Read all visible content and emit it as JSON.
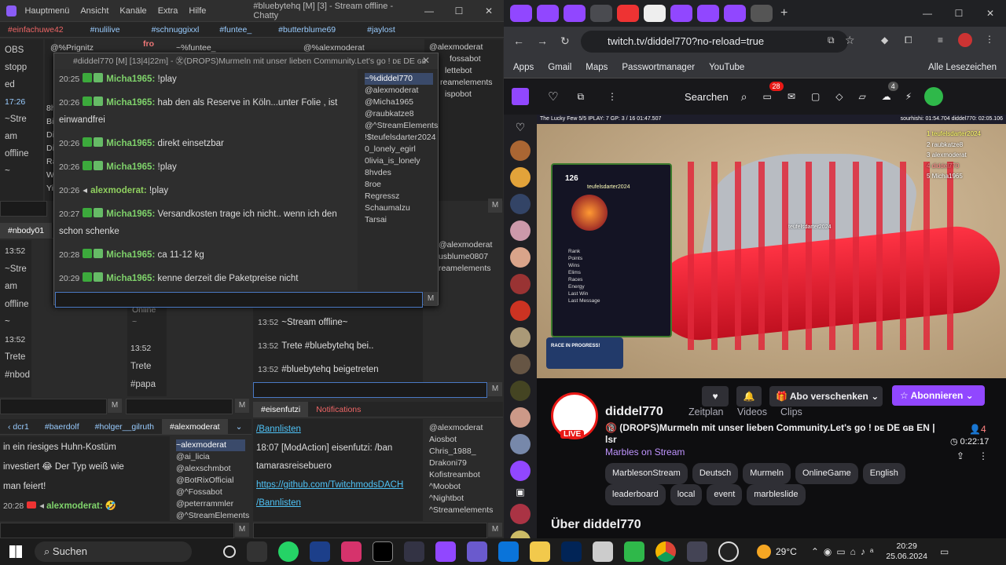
{
  "chatty": {
    "menu": [
      "Hauptmenü",
      "Ansicht",
      "Kanäle",
      "Extra",
      "Hilfe"
    ],
    "title": "#bluebytehq [M] [3] - Stream offline - Chatty",
    "win_controls": [
      "—",
      "☐",
      "✕"
    ],
    "tabs_top": [
      "#einfachuwe42",
      "#nulilive",
      "#schnuggixxl",
      "#funtee_",
      "#butterblume69",
      "#jaylost"
    ],
    "col1_lines": [
      "OBS",
      "stopp",
      "ed",
      "17:26",
      "~Stre",
      "am",
      "offline",
      "~"
    ],
    "col1_pre": "@%Prignitz",
    "col2_pre": "fro",
    "col3_pre": "~%funtee_",
    "col4_pre": "@%alexmoderat",
    "col5_list": [
      "@alexmoderat",
      "fossabot",
      "lettebot",
      "reamelements",
      "ispobot"
    ],
    "col1_side": [
      "8h",
      "Bi",
      "Di",
      "Di",
      "Ra",
      "W",
      "Yi"
    ],
    "mid_tabs": [
      "#nbody01"
    ],
    "mid_col1": [
      "13:52",
      "~Stre",
      "am",
      "offline",
      "~",
      "13:52",
      "Trete",
      "#nbod"
    ],
    "mid_col2": [
      "Online",
      "~"
    ],
    "mid_col3": [
      "13:52",
      "Trete",
      "#papa"
    ],
    "mid_main": [
      {
        "ts": "13:52",
        "text": "~Stream offline~"
      },
      {
        "ts": "13:52",
        "text": "Trete #bluebytehq bei.."
      },
      {
        "ts": "13:52",
        "text": "#bluebytehq beigetreten"
      }
    ],
    "mid_users": [
      "@alexmoderat",
      "usblume0807",
      "reamelements"
    ],
    "popup": {
      "header": "#diddel770 [M] [13|4|22m] - ㉆(DROPS)Murmeln mit unser lieben Community.Let's go ! ᴅᴇ DE ɢʙ",
      "close": "✕",
      "messages": [
        {
          "ts": "20:25",
          "nick": "Micha1965:",
          "text": "!play"
        },
        {
          "ts": "20:26",
          "nick": "Micha1965:",
          "text": "hab den als Reserve in Köln...unter Folie , ist einwandfrei"
        },
        {
          "ts": "20:26",
          "nick": "Micha1965:",
          "text": "direkt einsetzbar"
        },
        {
          "ts": "20:26",
          "nick": "Micha1965:",
          "text": "!play"
        },
        {
          "ts": "20:26",
          "nick": "alexmoderat:",
          "text": "!play"
        },
        {
          "ts": "20:27",
          "nick": "Micha1965:",
          "text": "Versandkosten trage ich nicht.. wenn ich den schon schenke"
        },
        {
          "ts": "20:28",
          "nick": "Micha1965:",
          "text": "ca 11-12 kg"
        },
        {
          "ts": "20:29",
          "nick": "Micha1965:",
          "text": "kenne derzeit die Paketpreise nicht"
        }
      ],
      "users": [
        "~%diddel770",
        "@alexmoderat",
        "@Micha1965",
        "@raubkatze8",
        "@^StreamElements",
        "!$teufelsdarter2024",
        "0_lonely_egirl",
        "0livia_is_lonely",
        "8hvdes",
        "8roe",
        "Regressz",
        "Schaumalzu",
        "Tarsai"
      ],
      "m": "M"
    },
    "bottom_tabs": [
      "dcr1",
      "#baerdolf",
      "#holger__gilruth",
      "#alexmoderat"
    ],
    "bottom_chat": [
      "in ein riesiges Huhn-Kostüm",
      "investiert 😂 Der Typ weiß wie",
      "man feiert!"
    ],
    "bottom_last": {
      "ts": "20:28",
      "nick": "alexmoderat:",
      "text": "🤣"
    },
    "bottom_users": [
      "~alexmoderat",
      "@ai_licia",
      "@alexschmbot",
      "@BotRixOfficial",
      "@^Fossabot",
      "@peterrammler",
      "@^StreamElements"
    ],
    "br_tabs": [
      "#eisenfutzi",
      "Notifications"
    ],
    "br_chat": [
      {
        "kind": "link",
        "text": "/Bannlisten"
      },
      {
        "kind": "text",
        "text": "18:07 [ModAction] eisenfutzi: /ban tamarasreisebuero"
      },
      {
        "kind": "link",
        "text": "https://github.com/TwitchmodsDACH"
      },
      {
        "kind": "link",
        "text": "/Bannlisten"
      }
    ],
    "br_users": [
      "@alexmoderat",
      "Aiosbot",
      "Chris_1988_",
      "Drakoni79",
      "Kofistreambot",
      "^Moobot",
      "^Nightbot",
      "^Streamelements"
    ],
    "m": "M"
  },
  "browser": {
    "url": "twitch.tv/diddel770?no-reload=true",
    "bookmarks": [
      "Apps",
      "Gmail",
      "Maps",
      "Passwortmanager",
      "YouTube"
    ],
    "all_bookmarks": "Alle Lesezeichen",
    "win_controls": [
      "—",
      "☐",
      "✕"
    ]
  },
  "twitch": {
    "search": "Searchen",
    "notif_count": "28",
    "prime_count": "4",
    "overlay_top": "The Lucky Few  5/5  IPLAY: 7  GP: 3 / 16  01:47.507",
    "overlay_right": "sourhishi: 01:54.704   diddel770: 02:05.106",
    "leaderboard": [
      "1 teufelsdarter2024",
      "2 raubkatze8",
      "3 alexmoderat",
      "4 diddel770",
      "5 Micha1965"
    ],
    "player_card": {
      "num": "126",
      "name": "teufelsdarter2024",
      "rows": [
        "Rank",
        "Points",
        "Wins",
        "Elims",
        "Races",
        "Energy",
        "Last Win",
        "Last Message"
      ]
    },
    "race_banner": "RACE IN PROGRESS!",
    "marble_label": "teufelsdarter2024",
    "channel": "diddel770",
    "nav": [
      "Zeitplan",
      "Videos",
      "Clips"
    ],
    "live": "LIVE",
    "title": "🔞 (DROPS)Murmeln mit unser lieben Community.Let's go ! ᴅᴇ DE ɢʙ EN | lsr",
    "category": "Marbles on Stream",
    "tags": [
      "MarblesonStream",
      "Deutsch",
      "Murmeln",
      "OnlineGame",
      "English",
      "leaderboard",
      "local",
      "event",
      "marbleslide"
    ],
    "viewers": "4",
    "uptime": "0:22:17",
    "gift": "Abo verschenken",
    "subscribe": "Abonnieren",
    "about": "Über diddel770"
  },
  "taskbar": {
    "search": "Suchen",
    "temp": "29°C",
    "time": "20:29",
    "date": "25.06.2024"
  },
  "colors": {
    "twitch": "#9147ff",
    "green": "#7fd36b",
    "link": "#4fc3f7"
  }
}
